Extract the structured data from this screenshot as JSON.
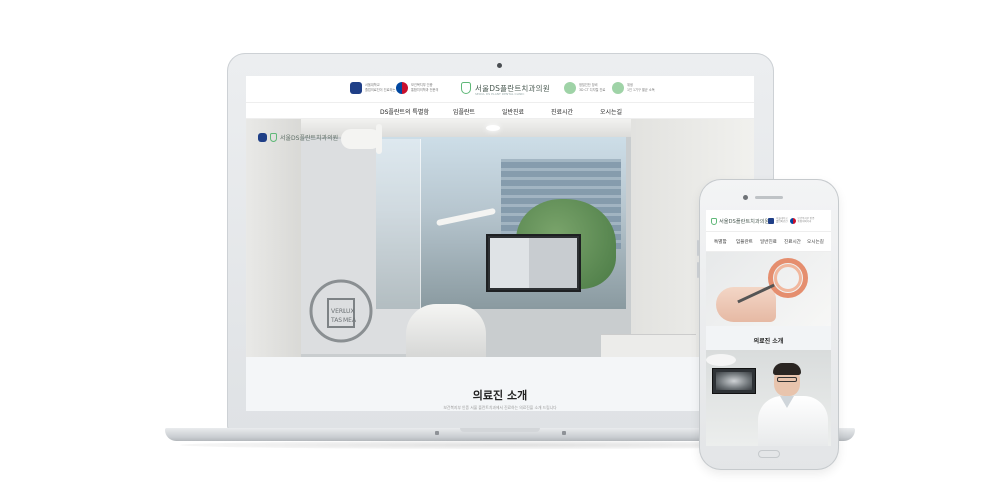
{
  "laptop": {
    "header": {
      "left_badge_1": [
        "서울대학교",
        "졸업의료진이 진료하는 치과"
      ],
      "left_badge_2": [
        "보건복지부 인증",
        "통합치의학과 전문의"
      ],
      "brand_name": "서울DS플란트치과의원",
      "brand_sub": "SEOUL DS PLANT DENTAL CLINIC",
      "right_badge_1": [
        "정밀진단 장비",
        "3D CT 디지털 진료"
      ],
      "right_badge_2": [
        "위생",
        "1인 1기구 멸균 소독"
      ]
    },
    "nav": [
      "DS플란트의 특별함",
      "임플란트",
      "일반진료",
      "진료시간",
      "오시는길"
    ],
    "hero": {
      "logo_text": "서울DS플란트치과의원",
      "seal_words": [
        "VERI",
        "LUX",
        "TAS",
        "MEA"
      ]
    },
    "intro": {
      "title": "의료진 소개",
      "description": "보건복지부 인증 서울 플란트치과에서 진료하는 의료진을 소개 드립니다"
    }
  },
  "phone": {
    "brand_name": "서울DS플란트치과의원",
    "badge_1": [
      "서울대학교",
      "졸업의료진"
    ],
    "badge_2": [
      "보건복지부 인증",
      "통합치의학과"
    ],
    "nav": [
      "특별함",
      "임플란트",
      "일반진료",
      "진료시간",
      "오시는길"
    ],
    "section_title": "의료진 소개"
  },
  "colors": {
    "brand_green": "#5fb878",
    "snu_blue": "#1f3f87",
    "text_dark": "#222222",
    "section_bg": "#f4f6f8"
  }
}
